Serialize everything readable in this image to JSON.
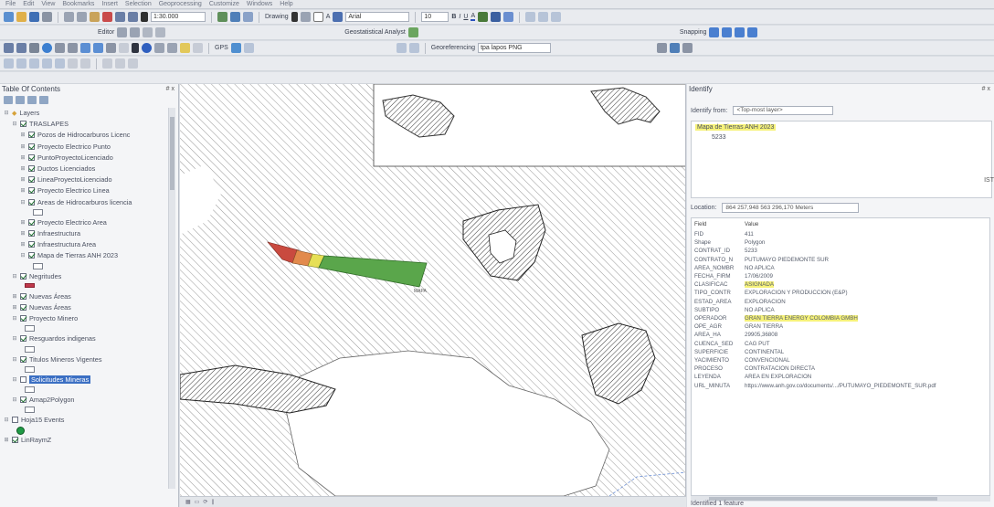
{
  "menubar": {
    "items": [
      "File",
      "Edit",
      "View",
      "Bookmarks",
      "Insert",
      "Selection",
      "Geoprocessing",
      "Customize",
      "Windows",
      "Help"
    ]
  },
  "toolbar": {
    "scale": "1:30.000",
    "editor_label": "Editor",
    "drawing_label": "Drawing",
    "font_name": "Arial",
    "font_size": "10",
    "geostatistical_label": "Geostatistical Analyst",
    "snapping_label": "Snapping",
    "gps_label": "GPS",
    "georeferencing_label": "Georeferencing",
    "georef_layer": "tpa lapos PNG"
  },
  "toc": {
    "title": "Table Of Contents",
    "close": "# x",
    "rows": [
      {
        "label": "Layers",
        "indent": 0,
        "checked": null,
        "exp": "⊟"
      },
      {
        "label": "TRASLAPES",
        "indent": 1,
        "checked": true,
        "exp": "⊟"
      },
      {
        "label": "Pozos de Hidrocarburos Licenc",
        "indent": 2,
        "checked": true,
        "exp": "⊞"
      },
      {
        "label": "Proyecto Electrico Punto",
        "indent": 2,
        "checked": true,
        "exp": "⊞"
      },
      {
        "label": "PuntoProyectoLicenciado",
        "indent": 2,
        "checked": true,
        "exp": "⊞"
      },
      {
        "label": "Ductos Licenciados",
        "indent": 2,
        "checked": true,
        "exp": "⊞"
      },
      {
        "label": "LineaProyectoLicenciado",
        "indent": 2,
        "checked": true,
        "exp": "⊞"
      },
      {
        "label": "Proyecto Electrico Linea",
        "indent": 2,
        "checked": true,
        "exp": "⊞"
      },
      {
        "label": "Areas de Hidrocarburos licencia",
        "indent": 2,
        "checked": true,
        "exp": "⊟"
      },
      {
        "label": "Proyecto Electrico Area",
        "indent": 2,
        "checked": true,
        "exp": "⊞"
      },
      {
        "label": "Infraestructura",
        "indent": 2,
        "checked": true,
        "exp": "⊞"
      },
      {
        "label": "Infraestructura Area",
        "indent": 2,
        "checked": true,
        "exp": "⊞"
      },
      {
        "label": "Mapa de Tierras ANH 2023",
        "indent": 2,
        "checked": true,
        "exp": "⊟"
      },
      {
        "label": "Negritudes",
        "indent": 1,
        "checked": true,
        "exp": "⊟"
      },
      {
        "label": "Nuevas Áreas",
        "indent": 1,
        "checked": true,
        "exp": "⊞"
      },
      {
        "label": "Nuevas Áreas",
        "indent": 1,
        "checked": true,
        "exp": "⊞"
      },
      {
        "label": "Proyecto Minero",
        "indent": 1,
        "checked": true,
        "exp": "⊟"
      },
      {
        "label": "Resguardos indigenas",
        "indent": 1,
        "checked": true,
        "exp": "⊟"
      },
      {
        "label": "Titulos Mineros Vigentes",
        "indent": 1,
        "checked": true,
        "exp": "⊟"
      },
      {
        "label": "Solicitudes Mineras",
        "indent": 1,
        "checked": false,
        "exp": "⊟"
      },
      {
        "label": "Amap2Polygon",
        "indent": 1,
        "checked": true,
        "exp": "⊟"
      },
      {
        "label": "Hoja15 Events",
        "indent": 0,
        "checked": false,
        "exp": "⊟"
      },
      {
        "label": "LinRaymZ",
        "indent": 0,
        "checked": true,
        "exp": "⊞"
      }
    ]
  },
  "map": {
    "center_label": "MAPA"
  },
  "identify": {
    "title": "Identify",
    "close": "# x",
    "from_label": "Identify from:",
    "from_value": "<Top-most layer>",
    "tree_layer": "Mapa de Tierras ANH 2023",
    "tree_feature": "5233",
    "scroll_tag": "IST",
    "location_label": "Location:",
    "location_value": "864 257,948 563 296,170 Meters",
    "columns": [
      "Field",
      "Value"
    ],
    "attributes": [
      {
        "field": "FID",
        "value": "411",
        "hl": false
      },
      {
        "field": "Shape",
        "value": "Polygon",
        "hl": false
      },
      {
        "field": "CONTRAT_ID",
        "value": "5233",
        "hl": false
      },
      {
        "field": "CONTRATO_N",
        "value": "PUTUMAYO PIEDEMONTE SUR",
        "hl": false
      },
      {
        "field": "AREA_NOMBR",
        "value": "NO APLICA",
        "hl": false
      },
      {
        "field": "FECHA_FIRM",
        "value": "17/06/2009",
        "hl": false
      },
      {
        "field": "CLASIFICAC",
        "value": "ASIGNADA",
        "hl": true
      },
      {
        "field": "TIPO_CONTR",
        "value": "EXPLORACION Y PRODUCCION (E&P)",
        "hl": false
      },
      {
        "field": "ESTAD_AREA",
        "value": "EXPLORACION",
        "hl": false
      },
      {
        "field": "SUBTIPO",
        "value": "NO APLICA",
        "hl": false
      },
      {
        "field": "OPERADOR",
        "value": "GRAN TIERRA ENERGY COLOMBIA GMBH",
        "hl": true
      },
      {
        "field": "OPE_AGR",
        "value": "GRAN TIERRA",
        "hl": false
      },
      {
        "field": "AREA_HA",
        "value": "29905,36808",
        "hl": false
      },
      {
        "field": "CUENCA_SED",
        "value": "CAG PUT",
        "hl": false
      },
      {
        "field": "SUPERFICIE",
        "value": "CONTINENTAL",
        "hl": false
      },
      {
        "field": "YACIMIENTO",
        "value": "CONVENCIONAL",
        "hl": false
      },
      {
        "field": "PROCESO",
        "value": "CONTRATACION DIRECTA",
        "hl": false
      },
      {
        "field": "LEYENDA",
        "value": "AREA EN EXPLORACION",
        "hl": false
      },
      {
        "field": "URL_MINUTA",
        "value": "https://www.anh.gov.co/documents/.../PUTUMAYO_PIEDEMONTE_SUR.pdf",
        "hl": false
      }
    ],
    "status": "Identified 1 feature"
  }
}
